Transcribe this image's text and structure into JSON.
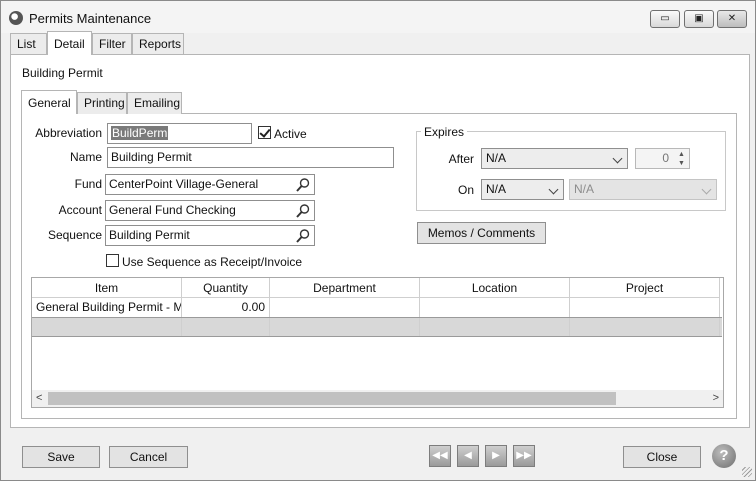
{
  "window": {
    "title": "Permits Maintenance",
    "minimize_glyph": "▭",
    "maximize_glyph": "▣",
    "close_glyph": "✕"
  },
  "tabs": [
    {
      "label": "List"
    },
    {
      "label": "Detail",
      "active": true
    },
    {
      "label": "Filter"
    },
    {
      "label": "Reports"
    }
  ],
  "record_title": "Building Permit",
  "subtabs": [
    {
      "label": "General",
      "active": true
    },
    {
      "label": "Printing"
    },
    {
      "label": "Emailing"
    }
  ],
  "form": {
    "abbreviation_label": "Abbreviation",
    "abbreviation_value": "BuildPerm",
    "active_label": "Active",
    "active_checked": true,
    "name_label": "Name",
    "name_value": "Building Permit",
    "fund_label": "Fund",
    "fund_value": "CenterPoint Village-General",
    "account_label": "Account",
    "account_value": "General Fund Checking",
    "sequence_label": "Sequence",
    "sequence_value": "Building Permit",
    "use_sequence_label": "Use Sequence as Receipt/Invoice",
    "use_sequence_checked": false
  },
  "expires": {
    "group_label": "Expires",
    "after_label": "After",
    "after_value": "N/A",
    "after_number": "0",
    "on_label": "On",
    "on_value": "N/A",
    "on_second_value": "N/A"
  },
  "memos_button": "Memos / Comments",
  "grid": {
    "columns": [
      "Item",
      "Quantity",
      "Department",
      "Location",
      "Project"
    ],
    "rows": [
      {
        "item": "General Building Permit - M",
        "quantity": "0.00",
        "department": "",
        "location": "",
        "project": ""
      }
    ]
  },
  "footer": {
    "save": "Save",
    "cancel": "Cancel",
    "close": "Close",
    "nav_first": "◀◀",
    "nav_prev": "◀",
    "nav_next": "▶",
    "nav_last": "▶▶",
    "help": "?"
  },
  "icons": {
    "app": "app-logo-icon",
    "lookup": "magnifier-icon",
    "help": "help-icon"
  }
}
